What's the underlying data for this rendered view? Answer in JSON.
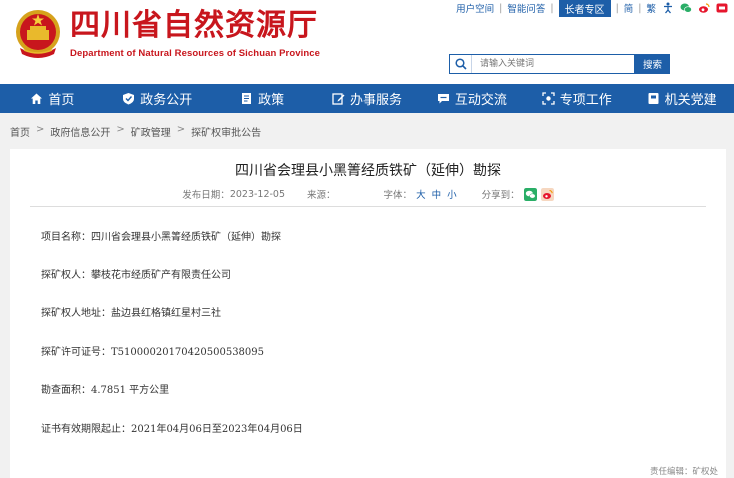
{
  "header": {
    "title": "四川省自然资源厅",
    "subtitle": "Department of Natural Resources of Sichuan Province",
    "top_links": [
      "用户空间",
      "智能问答",
      "长者专区",
      "简",
      "繁"
    ],
    "search_placeholder": "请输入关键词",
    "search_button": "搜索"
  },
  "nav": {
    "items": [
      {
        "label": "首页",
        "icon": "home-icon"
      },
      {
        "label": "政务公开",
        "icon": "shield-icon"
      },
      {
        "label": "政策",
        "icon": "document-icon"
      },
      {
        "label": "办事服务",
        "icon": "edit-icon"
      },
      {
        "label": "互动交流",
        "icon": "chat-icon"
      },
      {
        "label": "专项工作",
        "icon": "focus-icon"
      },
      {
        "label": "机关党建",
        "icon": "book-icon"
      }
    ]
  },
  "breadcrumb": [
    "首页",
    "政府信息公开",
    "矿政管理",
    "探矿权审批公告"
  ],
  "article": {
    "title": "四川省会理县小黑箐经质铁矿（延伸）勘探",
    "date_label": "发布日期：",
    "date": "2023-12-05",
    "source_label": "来源：",
    "font_label": "字体：",
    "font_sizes": [
      "大",
      "中",
      "小"
    ],
    "share_label": "分享到：",
    "paragraphs": [
      "项目名称：四川省会理县小黑箐经质铁矿（延伸）勘探",
      "探矿权人：攀枝花市经质矿产有限责任公司",
      "探矿权人地址：盐边县红格镇红星村三社",
      "探矿许可证号：T51000020170420500538095",
      "勘查面积：4.7851 平方公里",
      "证书有效期限起止：2021年04月06日至2023年04月06日"
    ],
    "editor": "责任编辑：矿权处"
  },
  "colors": {
    "brand_red": "#c8161d",
    "nav_blue": "#1d5ea8"
  }
}
